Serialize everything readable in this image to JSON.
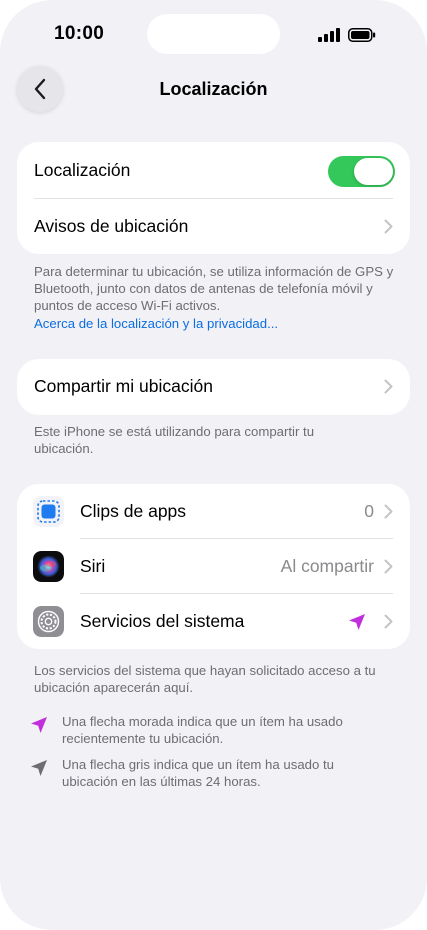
{
  "status_bar": {
    "time": "10:00"
  },
  "nav": {
    "title": "Localización"
  },
  "section1": {
    "location_label": "Localización",
    "location_on": true,
    "alerts_label": "Avisos de ubicación"
  },
  "footer1": {
    "text": "Para determinar tu ubicación, se utiliza información de GPS y Bluetooth, junto con datos de antenas de telefonía móvil y puntos de acceso Wi-Fi activos.",
    "link": "Acerca de la localización y la privacidad..."
  },
  "section2": {
    "share_label": "Compartir mi ubicación"
  },
  "footer2": {
    "text": "Este iPhone se está utilizando para compartir tu ubicación."
  },
  "apps": [
    {
      "label": "Clips de apps",
      "value": "0",
      "icon": "app-clips-icon"
    },
    {
      "label": "Siri",
      "value": "Al compartir",
      "icon": "siri-icon"
    },
    {
      "label": "Servicios del sistema",
      "value": "",
      "icon": "settings-gear-icon"
    }
  ],
  "footer3": {
    "text": "Los servicios del sistema que hayan solicitado acceso a tu ubicación aparecerán aquí.",
    "legend_purple": "Una flecha morada indica que un ítem ha usado recientemente tu ubicación.",
    "legend_gray": "Una flecha gris indica que un ítem ha usado tu ubicación en las últimas 24 horas."
  },
  "colors": {
    "accent": "#0a6ee0",
    "toggle_on": "#34c759",
    "purple_arrow": "#c12fdc",
    "gray_arrow": "#6d6d72"
  }
}
